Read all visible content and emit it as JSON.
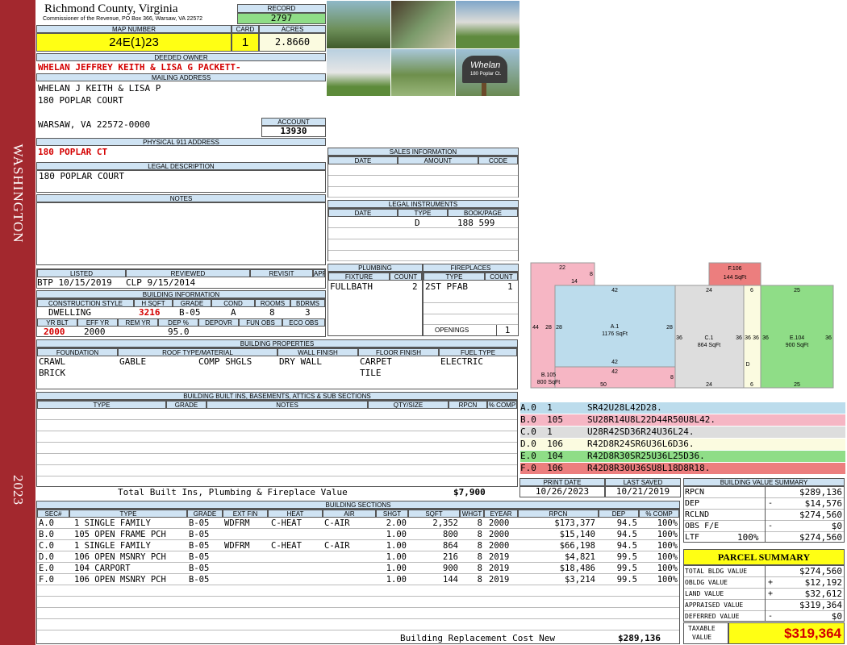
{
  "sidebar": {
    "district": "WASHINGTON",
    "year": "2023"
  },
  "header": {
    "county": "Richmond County, Virginia",
    "commissioner": "Commissioner of the Revenue, PO Box 366, Warsaw, VA 22572",
    "record_label": "RECORD",
    "record": "2797",
    "map_label": "MAP NUMBER",
    "map_number": "24E(1)23",
    "card_label": "CARD",
    "card": "1",
    "acres_label": "ACRES",
    "acres": "2.8660"
  },
  "owner": {
    "label": "DEEDED OWNER",
    "name": "WHELAN JEFFREY KEITH & LISA G PACKETT-"
  },
  "mailing": {
    "label": "MAILING ADDRESS",
    "line1": "WHELAN J KEITH & LISA P",
    "line2": "180 POPLAR COURT",
    "line3": "WARSAW, VA 22572-0000",
    "account_label": "ACCOUNT",
    "account": "13930"
  },
  "physical": {
    "label": "PHYSICAL 911 ADDRESS",
    "value": "180 POPLAR CT"
  },
  "legal": {
    "label": "LEGAL DESCRIPTION",
    "value": "180 POPLAR COURT"
  },
  "notes": {
    "label": "NOTES"
  },
  "photos": {
    "mailbox_line1": "Whelan",
    "mailbox_line2": "180 Poplar Ct."
  },
  "sales": {
    "label": "SALES INFORMATION",
    "cols": [
      "DATE",
      "AMOUNT",
      "CODE"
    ]
  },
  "instruments": {
    "label": "LEGAL INSTRUMENTS",
    "cols": [
      "DATE",
      "TYPE",
      "BOOK/PAGE"
    ],
    "type": "D",
    "bookpage": "188 599"
  },
  "review": {
    "cols": [
      "LISTED",
      "REVIEWED",
      "REVISIT",
      "APPEALS"
    ],
    "listed": "BTP 10/15/2019",
    "reviewed": "CLP  9/15/2014"
  },
  "plumbing": {
    "label": "PLUMBING",
    "cols": [
      "FIXTURE",
      "COUNT"
    ],
    "fixture": "FULLBATH",
    "count": "2"
  },
  "fireplaces": {
    "label": "FIREPLACES",
    "cols": [
      "TYPE",
      "COUNT"
    ],
    "type": "2ST PFAB",
    "count": "1",
    "openings_label": "OPENINGS",
    "openings": "1"
  },
  "building_info": {
    "label": "BUILDING INFORMATION",
    "cols": [
      "CONSTRUCTION STYLE",
      "H SQFT",
      "GRADE",
      "COND",
      "ROOMS",
      "BDRMS"
    ],
    "style": "DWELLING",
    "hsqft": "3216",
    "grade": "B-05",
    "cond": "A",
    "rooms": "8",
    "bdrms": "3",
    "cols2": [
      "YR BLT",
      "EFF YR",
      "REM YR",
      "DEP %",
      "DEPOVR",
      "FUN OBS",
      "ECO OBS"
    ],
    "yrblt": "2000",
    "effyr": "2000",
    "dep": "95.0"
  },
  "properties": {
    "label": "BUILDING PROPERTIES",
    "cols": [
      "FOUNDATION",
      "ROOF TYPE/MATERIAL",
      "WALL FINISH",
      "FLOOR FINISH",
      "FUEL TYPE"
    ],
    "foundation1": "CRAWL",
    "foundation2": "BRICK",
    "roof1": "GABLE",
    "roof2": "COMP SHGLS",
    "wall": "DRY WALL",
    "floor1": "CARPET",
    "floor2": "TILE",
    "fuel": "ELECTRIC"
  },
  "builtins": {
    "label": "BUILDING BUILT INS, BASEMENTS, ATTICS & SUB SECTIONS",
    "cols": [
      "TYPE",
      "GRADE",
      "NOTES",
      "QTY/SIZE",
      "RPCN",
      "% COMP"
    ],
    "total_label": "Total Built Ins, Plumbing & Fireplace Value",
    "total": "$7,900"
  },
  "dates": {
    "print_label": "PRINT DATE",
    "print": "10/26/2023",
    "saved_label": "LAST SAVED",
    "saved": "10/21/2019"
  },
  "sketch": {
    "areas": [
      {
        "label": "A.1",
        "sqft": "1176 SqFt"
      },
      {
        "label": "B.105",
        "sqft": "800 SqFt"
      },
      {
        "label": "C.1",
        "sqft": "864 SqFt"
      },
      {
        "label": "D",
        "sqft": ""
      },
      {
        "label": "E.104",
        "sqft": "900 SqFt"
      },
      {
        "label": "F.106",
        "sqft": "144 SqFt"
      }
    ],
    "dims": [
      "22",
      "8",
      "14",
      "42",
      "24",
      "6",
      "25",
      "44",
      "28",
      "28",
      "28",
      "36",
      "36",
      "36",
      "36",
      "36",
      "36",
      "42",
      "42",
      "50",
      "8",
      "24",
      "6",
      "25"
    ]
  },
  "legend": [
    {
      "code": "A.0",
      "num": "1",
      "desc": "SR42U28L42D28.",
      "color": "#bcdcec"
    },
    {
      "code": "B.0",
      "num": "105",
      "desc": "SU28R14U8L22D44R50U8L42.",
      "color": "#f6b6c4"
    },
    {
      "code": "C.0",
      "num": "1",
      "desc": "U28R42SD36R24U36L24.",
      "color": "#dddddd"
    },
    {
      "code": "D.0",
      "num": "106",
      "desc": "R42D8R24SR6U36L6D36.",
      "color": "#fbfbe0"
    },
    {
      "code": "E.0",
      "num": "104",
      "desc": "R42D8R30SR25U36L25D36.",
      "color": "#8fdd87"
    },
    {
      "code": "F.0",
      "num": "106",
      "desc": "R42D8R30U36SU8L18D8R18.",
      "color": "#ec7e7e"
    }
  ],
  "sections": {
    "label": "BUILDING SECTIONS",
    "cols": [
      "SEC#",
      "TYPE",
      "GRADE",
      "EXT FIN",
      "HEAT",
      "AIR",
      "SHGT",
      "SQFT",
      "WHGT",
      "EYEAR",
      "RPCN",
      "DEP",
      "% COMP"
    ],
    "rows": [
      [
        "A.0",
        "  1 SINGLE FAMILY",
        "B-05",
        "WDFRM",
        "C-HEAT",
        "C-AIR",
        "2.00",
        "2,352",
        "8",
        "2000",
        "$173,377",
        "94.5",
        "100%"
      ],
      [
        "B.0",
        "105 OPEN FRAME PCH",
        "B-05",
        "",
        "",
        "",
        "1.00",
        "800",
        "8",
        "2000",
        "$15,140",
        "94.5",
        "100%"
      ],
      [
        "C.0",
        "  1 SINGLE FAMILY",
        "B-05",
        "WDFRM",
        "C-HEAT",
        "C-AIR",
        "1.00",
        "864",
        "8",
        "2000",
        "$66,198",
        "94.5",
        "100%"
      ],
      [
        "D.0",
        "106 OPEN MSNRY PCH",
        "B-05",
        "",
        "",
        "",
        "1.00",
        "216",
        "8",
        "2019",
        "$4,821",
        "99.5",
        "100%"
      ],
      [
        "E.0",
        "104 CARPORT",
        "B-05",
        "",
        "",
        "",
        "1.00",
        "900",
        "8",
        "2019",
        "$18,486",
        "99.5",
        "100%"
      ],
      [
        "F.0",
        "106 OPEN MSNRY PCH",
        "B-05",
        "",
        "",
        "",
        "1.00",
        "144",
        "8",
        "2019",
        "$3,214",
        "99.5",
        "100%"
      ]
    ],
    "replacement_label": "Building Replacement Cost New",
    "replacement": "$289,136"
  },
  "bvs": {
    "label": "BUILDING VALUE SUMMARY",
    "rows": [
      {
        "k": "RPCN",
        "s": "",
        "v": "$289,136"
      },
      {
        "k": "DEP",
        "s": "-",
        "v": "$14,576"
      },
      {
        "k": "RCLND",
        "s": "",
        "v": "$274,560"
      },
      {
        "k": "OBS F/E",
        "s": "-",
        "v": "$0"
      },
      {
        "k": "LTF",
        "pct": "100%",
        "s": "",
        "v": "$274,560"
      }
    ]
  },
  "parcel": {
    "label": "PARCEL SUMMARY",
    "rows": [
      {
        "k": "TOTAL BLDG VALUE",
        "s": "",
        "v": "$274,560"
      },
      {
        "k": "OBLDG VALUE",
        "s": "+",
        "v": "$12,192"
      },
      {
        "k": "LAND VALUE",
        "s": "+",
        "v": "$32,612"
      },
      {
        "k": "APPRAISED VALUE",
        "s": "",
        "v": "$319,364"
      },
      {
        "k": "DEFERRED VALUE",
        "s": "-",
        "v": "$0"
      }
    ],
    "taxable_label1": "TAXABLE",
    "taxable_label2": "VALUE",
    "taxable": "$319,364"
  }
}
